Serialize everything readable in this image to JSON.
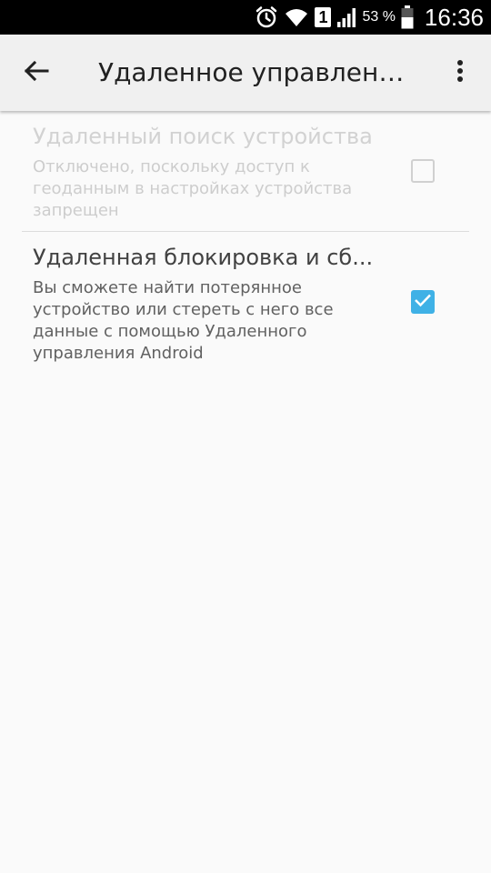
{
  "status_bar": {
    "sim_slot": "1",
    "battery_percent": "53 %",
    "time": "16:36",
    "icons": [
      "alarm-icon",
      "wifi-icon",
      "sim-icon",
      "signal-icon",
      "battery-icon"
    ]
  },
  "app_bar": {
    "title": "Удаленное управление...",
    "back_icon": "arrow-back-icon",
    "more_icon": "more-vert-icon"
  },
  "preferences": [
    {
      "title": "Удаленный поиск устройства",
      "summary": "Отключено, поскольку доступ к геоданным в настройках устройства запрещен",
      "enabled": false,
      "checked": false
    },
    {
      "title": "Удаленная блокировка и сб...",
      "summary": "Вы сможете найти потерянное устройство или стереть с него все данные с помощью Удаленного управления Android",
      "enabled": true,
      "checked": true
    }
  ],
  "colors": {
    "status_bar": "#000000",
    "app_bar": "#f0f0f0",
    "background": "#fafafa",
    "checkbox_accent": "#3fb1e6",
    "disabled_text": "#d2d2d2"
  }
}
